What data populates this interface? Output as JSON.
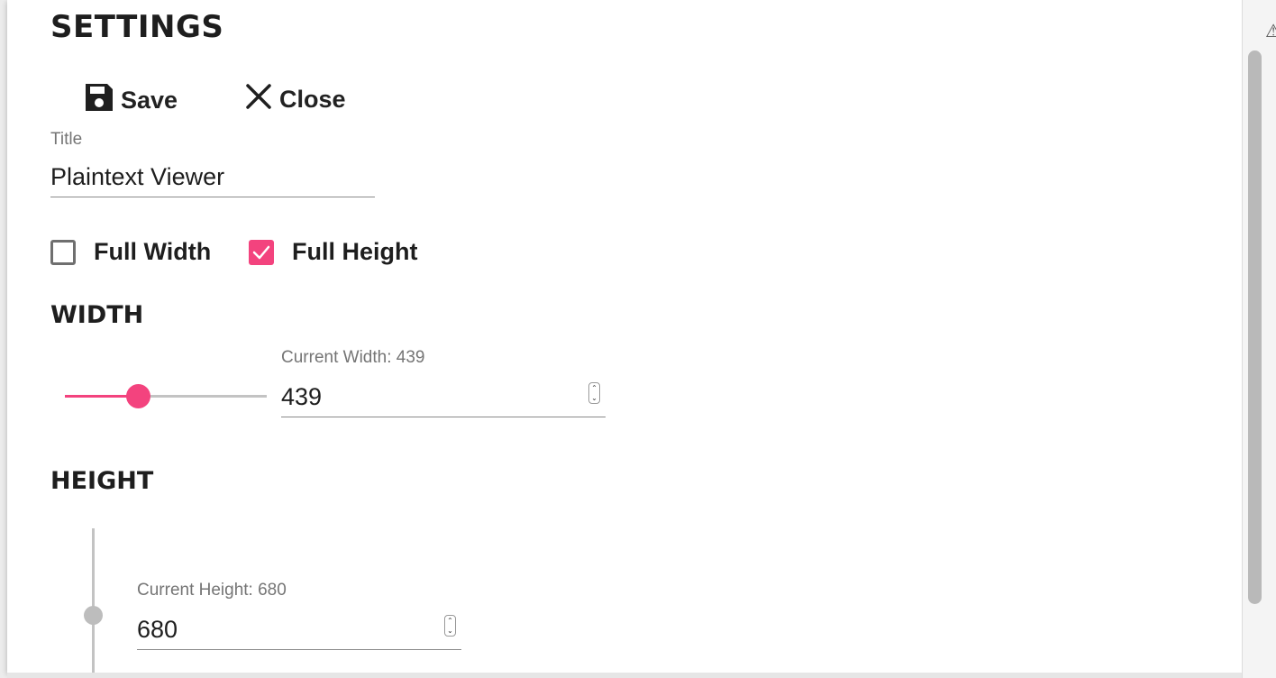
{
  "settings": {
    "heading": "SETTINGS",
    "toolbar": {
      "save_label": "Save",
      "close_label": "Close"
    },
    "title_field": {
      "label": "Title",
      "value": "Plaintext Viewer"
    },
    "checkboxes": {
      "full_width": {
        "label": "Full Width",
        "checked": false
      },
      "full_height": {
        "label": "Full Height",
        "checked": true
      }
    },
    "width": {
      "heading": "WIDTH",
      "current_label": "Current Width: 439",
      "value": "439",
      "slider_fraction": 0.37
    },
    "height": {
      "heading": "HEIGHT",
      "current_label": "Current Height: 680",
      "value": "680"
    }
  },
  "icons": {
    "save": "floppy-disk-icon",
    "close": "close-x-icon",
    "check": "checkmark-icon"
  },
  "colors": {
    "accent": "#f3437e",
    "disabled": "#bdbdbd"
  }
}
